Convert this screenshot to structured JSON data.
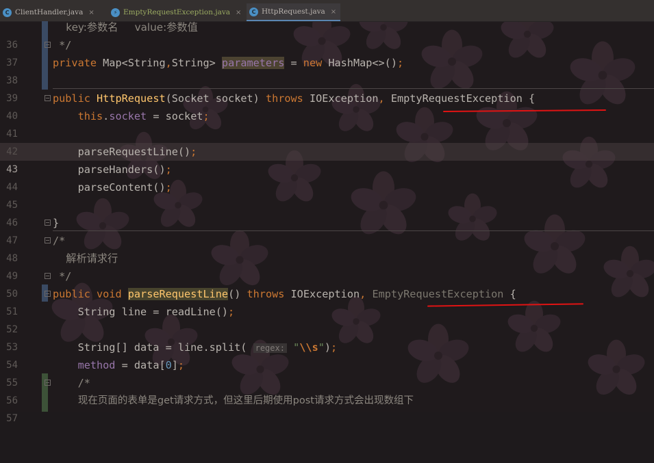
{
  "tabs": [
    {
      "icon": "C",
      "label": "ClientHandler.java",
      "active": false,
      "close": "×"
    },
    {
      "icon": "⚡",
      "label": "EmptyRequestException.java",
      "active": false,
      "close": "×"
    },
    {
      "icon": "C",
      "label": "HttpRequest.java",
      "active": true,
      "close": "×"
    }
  ],
  "lines": [
    {
      "n": "36",
      "text": "    key:参数名     value:参数值"
    },
    {
      "n": "37",
      "text": " */"
    },
    {
      "n": "38",
      "text": "private Map<String,String> parameters = new HashMap<>();"
    },
    {
      "n": "39",
      "text": ""
    },
    {
      "n": "40",
      "text": "public HttpRequest(Socket socket) throws IOException, EmptyRequestException {"
    },
    {
      "n": "41",
      "text": "    this.socket = socket;"
    },
    {
      "n": "42",
      "text": ""
    },
    {
      "n": "43",
      "text": "    parseRequestLine();"
    },
    {
      "n": "44",
      "text": "    parseHanders();"
    },
    {
      "n": "45",
      "text": "    parseContent();"
    },
    {
      "n": "46",
      "text": ""
    },
    {
      "n": "47",
      "text": "}"
    },
    {
      "n": "48",
      "text": "/*"
    },
    {
      "n": "49",
      "text": "    解析请求行"
    },
    {
      "n": "50",
      "text": " */"
    },
    {
      "n": "51",
      "text": "public void parseRequestLine() throws IOException, EmptyRequestException {"
    },
    {
      "n": "52",
      "text": "    String line = readLine();"
    },
    {
      "n": "53",
      "text": ""
    },
    {
      "n": "54",
      "text": "    String[] data = line.split( regex: \"\\\\s\");"
    },
    {
      "n": "55",
      "text": "    method = data[0];"
    },
    {
      "n": "56",
      "text": "    /*"
    },
    {
      "n": "57",
      "text": "        现在页面的表单是get请求方式，但这里后期使用post请求方式会出现数组下"
    }
  ],
  "current_line": "43",
  "colors": {
    "keyword": "#cc7832",
    "method_decl": "#ffc66d",
    "field": "#9876aa",
    "comment": "#8c877f",
    "string": "#6a8759",
    "number": "#6897bb",
    "annotation_underline": "#e11313",
    "active_tab_underline": "#5a86b2"
  }
}
